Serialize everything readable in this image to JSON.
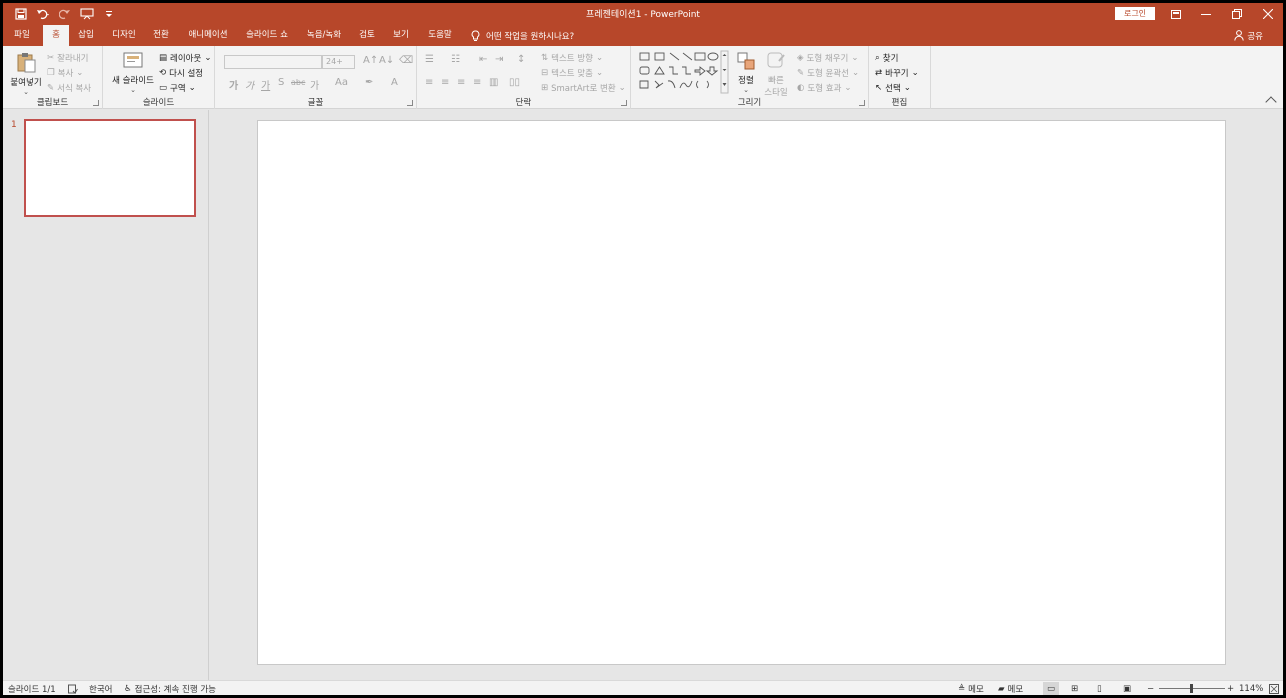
{
  "title_bar": {
    "title": "프레젠테이션1  -  PowerPoint",
    "login_label": "로그인",
    "icons": [
      "save-icon",
      "undo-icon",
      "redo-icon",
      "start-slideshow-icon",
      "customize-qat-icon",
      "ribbon-display-icon",
      "minimize-icon",
      "restore-icon",
      "close-icon"
    ]
  },
  "tabs": {
    "items": [
      "파일",
      "홈",
      "삽입",
      "디자인",
      "전환",
      "애니메이션",
      "슬라이드 쇼",
      "녹음/녹화",
      "검토",
      "보기",
      "도움말"
    ],
    "active": "홈",
    "tell_me": "어떤 작업을 원하시나요?",
    "share": "공유"
  },
  "ribbon": {
    "clipboard": {
      "label": "클립보드",
      "paste": "붙여넣기",
      "cut": "잘라내기",
      "copy": "복사",
      "format_painter": "서식 복사"
    },
    "slides": {
      "label": "슬라이드",
      "new_slide": "새 슬라이드",
      "layout": "레이아웃",
      "reset": "다시 설정",
      "section": "구역"
    },
    "font": {
      "label": "글꼴",
      "font_name": "",
      "font_size": "24+",
      "bold": "가",
      "italic": "가",
      "underline": "가",
      "shadow": "S",
      "strike": "abc",
      "spacing": "가",
      "change_case": "Aa"
    },
    "paragraph": {
      "label": "단락",
      "text_direction": "텍스트 방향",
      "align_text": "텍스트 맞춤",
      "smartart": "SmartArt로 변환"
    },
    "drawing": {
      "label": "그리기",
      "arrange": "정렬",
      "quick_styles_1": "빠른",
      "quick_styles_2": "스타일",
      "shape_fill": "도형 채우기",
      "shape_outline": "도형 윤곽선",
      "shape_effects": "도형 효과"
    },
    "editing": {
      "label": "편집",
      "find": "찾기",
      "replace": "바꾸기",
      "select": "선택"
    }
  },
  "slides_pane": {
    "slide_number": "1"
  },
  "status_bar": {
    "slide_info": "슬라이드 1/1",
    "language": "한국어",
    "accessibility": "접근성: 계속 진행 가능",
    "notes": "메모",
    "comments": "메모",
    "zoom": "114%",
    "zoom_minus": "−",
    "zoom_plus": "+"
  },
  "colors": {
    "accent": "#b7472a",
    "ribbon_bg": "#f3f3f3",
    "workspace_bg": "#e6e6e6"
  }
}
